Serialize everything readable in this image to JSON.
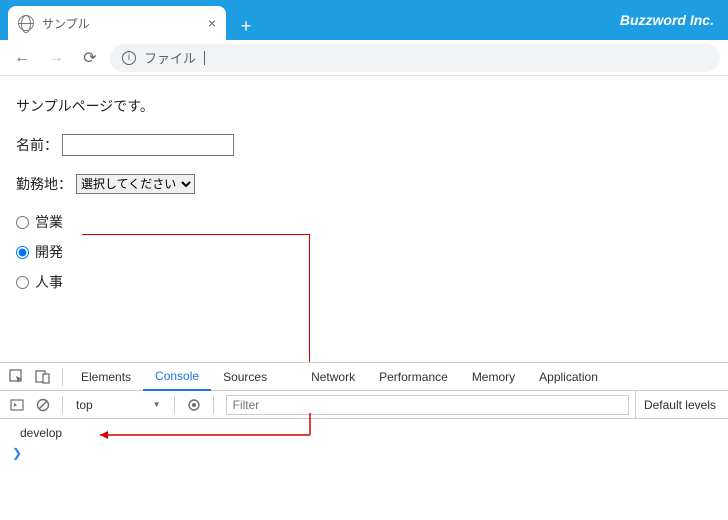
{
  "window": {
    "brand": "Buzzword Inc.",
    "tab_title": "サンプル",
    "new_tab_glyph": "+",
    "tab_close_glyph": "×"
  },
  "addr": {
    "back_glyph": "←",
    "forward_glyph": "→",
    "reload_glyph": "⟳",
    "info_glyph": "i",
    "url_label": "ファイル"
  },
  "page": {
    "paragraph": "サンプルページです。",
    "name_label": "名前：",
    "name_value": "",
    "location_label": "勤務地：",
    "location_selected": "選択してください",
    "radios": [
      {
        "label": "営業",
        "checked": false
      },
      {
        "label": "開発",
        "checked": true
      },
      {
        "label": "人事",
        "checked": false
      }
    ]
  },
  "devtools": {
    "tabs": [
      "Elements",
      "Console",
      "Sources",
      "Network",
      "Performance",
      "Memory",
      "Application"
    ],
    "active_tab": "Console",
    "context": "top",
    "filter_placeholder": "Filter",
    "levels_label": "Default levels",
    "console_output": "develop",
    "prompt_glyph": "❯"
  }
}
